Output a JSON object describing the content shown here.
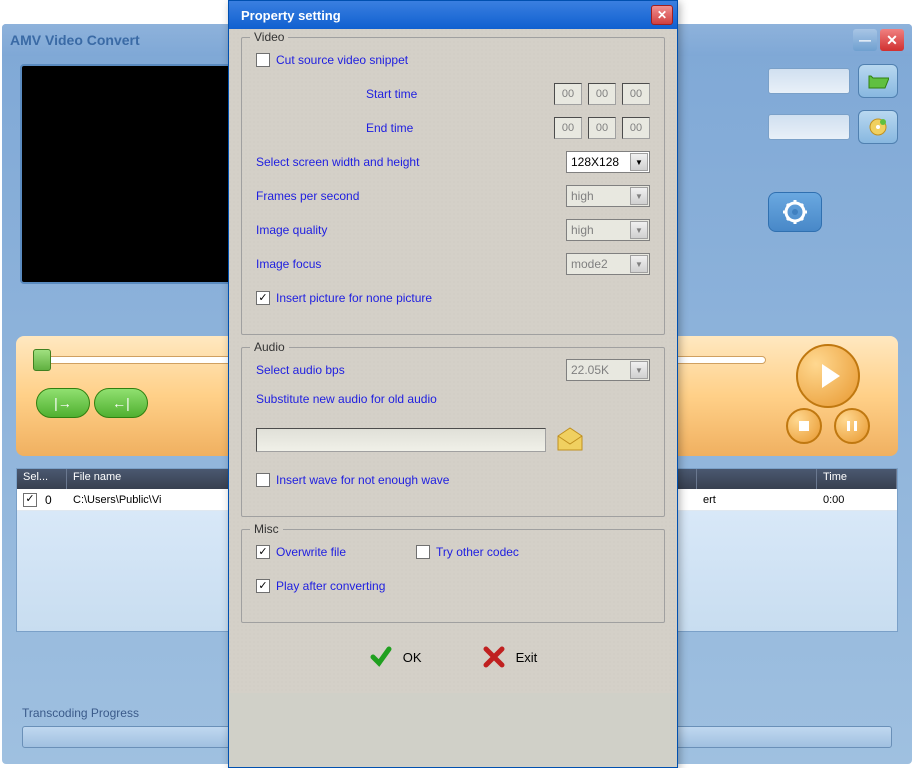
{
  "mainWindow": {
    "title": "AMV Video Convert"
  },
  "table": {
    "headers": {
      "sel": "Sel...",
      "fileName": "File name",
      "status": "",
      "time": "Time"
    },
    "rows": [
      {
        "index": "0",
        "checked": true,
        "fileName": "C:\\Users\\Public\\Vi",
        "status": "ert",
        "time": "0:00"
      }
    ]
  },
  "progress": {
    "label": "Transcoding Progress"
  },
  "dialog": {
    "title": "Property setting",
    "video": {
      "legend": "Video",
      "cutSource": "Cut source video snippet",
      "cutSourceChecked": false,
      "startTime": "Start time",
      "endTime": "End time",
      "startVals": [
        "00",
        "00",
        "00"
      ],
      "endVals": [
        "00",
        "00",
        "00"
      ],
      "screenSize": "Select screen width and height",
      "screenSizeVal": "128X128",
      "fps": "Frames per second",
      "fpsVal": "high",
      "quality": "Image quality",
      "qualityVal": "high",
      "focus": "Image focus",
      "focusVal": "mode2",
      "insertPic": "Insert picture for none picture",
      "insertPicChecked": true
    },
    "audio": {
      "legend": "Audio",
      "bps": "Select audio bps",
      "bpsVal": "22.05K",
      "substitute": "Substitute new audio for old audio",
      "insertWave": "Insert wave for not enough wave",
      "insertWaveChecked": false
    },
    "misc": {
      "legend": "Misc",
      "overwrite": "Overwrite file",
      "overwriteChecked": true,
      "tryCodec": "Try other codec",
      "tryCodecChecked": false,
      "playAfter": "Play after converting",
      "playAfterChecked": true
    },
    "buttons": {
      "ok": "OK",
      "exit": "Exit"
    }
  }
}
